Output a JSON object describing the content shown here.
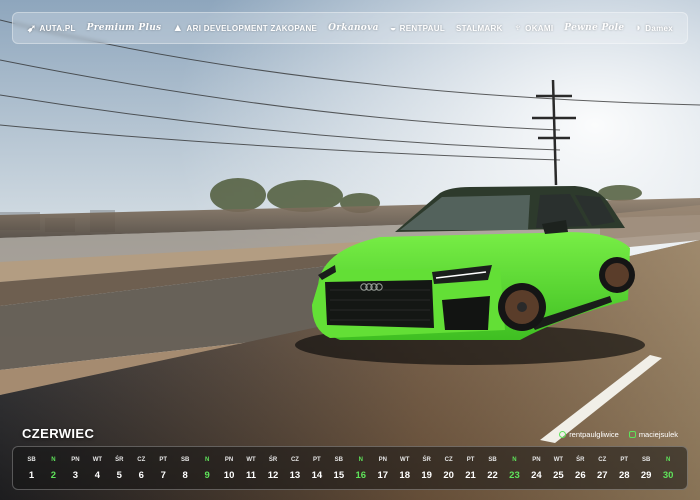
{
  "sponsors": [
    {
      "icon": "arrow-logo-icon",
      "name": "AUTA.PL"
    },
    {
      "icon": "",
      "name": "Premium Plus"
    },
    {
      "icon": "mountain-icon",
      "name": "ARI DEVELOPMENT ZAKOPANE"
    },
    {
      "icon": "",
      "name": "Orkanova"
    },
    {
      "icon": "car-outline-icon",
      "name": "RENTPAUL"
    },
    {
      "icon": "",
      "name": "STALMARK"
    },
    {
      "icon": "crest-icon",
      "name": "OKAMI"
    },
    {
      "icon": "",
      "name": "Pewne Pole"
    },
    {
      "icon": "d-logo-icon",
      "name": "Damex"
    }
  ],
  "calendar": {
    "month": "CZERWIEC",
    "days": [
      {
        "dow": "SB",
        "num": "1",
        "type": "sat"
      },
      {
        "dow": "N",
        "num": "2",
        "type": "sun"
      },
      {
        "dow": "PN",
        "num": "3",
        "type": "day"
      },
      {
        "dow": "WT",
        "num": "4",
        "type": "day"
      },
      {
        "dow": "ŚR",
        "num": "5",
        "type": "day"
      },
      {
        "dow": "CZ",
        "num": "6",
        "type": "day"
      },
      {
        "dow": "PT",
        "num": "7",
        "type": "day"
      },
      {
        "dow": "SB",
        "num": "8",
        "type": "sat"
      },
      {
        "dow": "N",
        "num": "9",
        "type": "sun"
      },
      {
        "dow": "PN",
        "num": "10",
        "type": "day"
      },
      {
        "dow": "WT",
        "num": "11",
        "type": "day"
      },
      {
        "dow": "ŚR",
        "num": "12",
        "type": "day"
      },
      {
        "dow": "CZ",
        "num": "13",
        "type": "day"
      },
      {
        "dow": "PT",
        "num": "14",
        "type": "day"
      },
      {
        "dow": "SB",
        "num": "15",
        "type": "sat"
      },
      {
        "dow": "N",
        "num": "16",
        "type": "sun"
      },
      {
        "dow": "PN",
        "num": "17",
        "type": "day"
      },
      {
        "dow": "WT",
        "num": "18",
        "type": "day"
      },
      {
        "dow": "ŚR",
        "num": "19",
        "type": "day"
      },
      {
        "dow": "CZ",
        "num": "20",
        "type": "day"
      },
      {
        "dow": "PT",
        "num": "21",
        "type": "day"
      },
      {
        "dow": "SB",
        "num": "22",
        "type": "sat"
      },
      {
        "dow": "N",
        "num": "23",
        "type": "sun"
      },
      {
        "dow": "PN",
        "num": "24",
        "type": "day"
      },
      {
        "dow": "WT",
        "num": "25",
        "type": "day"
      },
      {
        "dow": "ŚR",
        "num": "26",
        "type": "day"
      },
      {
        "dow": "CZ",
        "num": "27",
        "type": "day"
      },
      {
        "dow": "PT",
        "num": "28",
        "type": "day"
      },
      {
        "dow": "SB",
        "num": "29",
        "type": "sat"
      },
      {
        "dow": "N",
        "num": "30",
        "type": "sun"
      }
    ]
  },
  "socials": [
    {
      "icon": "tripadvisor-icon",
      "handle": "rentpaulgliwice"
    },
    {
      "icon": "instagram-icon",
      "handle": "maciejsulek"
    }
  ],
  "colors": {
    "accent": "#5fe35a",
    "car": "#5ad62f",
    "sky_top": "#9fb4c8",
    "sky_bottom": "#f2f2ee"
  }
}
